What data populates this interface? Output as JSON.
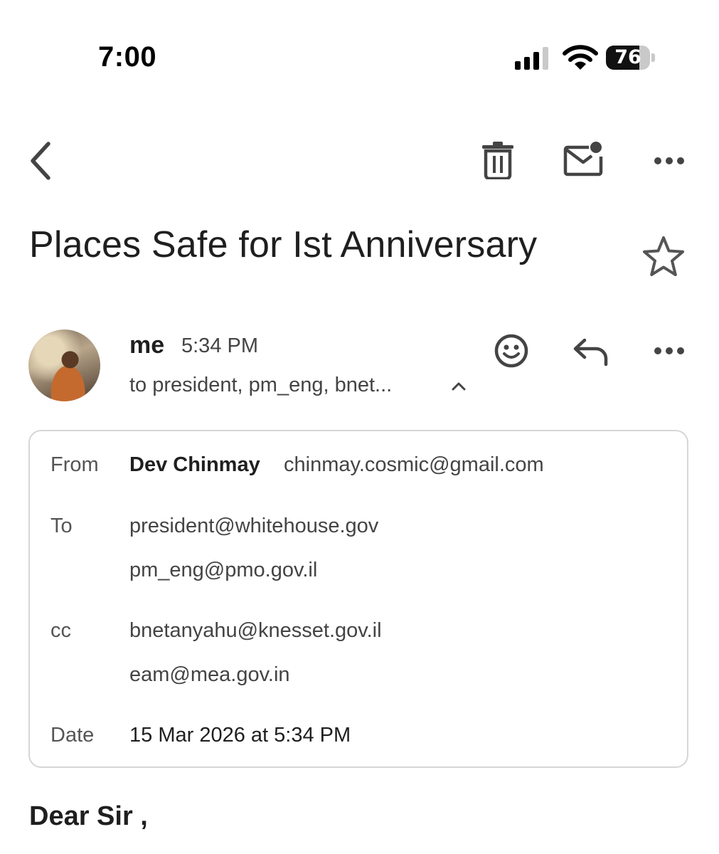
{
  "status_bar": {
    "time": "7:00",
    "battery_level": "76",
    "battery_fraction": 0.76
  },
  "toolbar": {
    "back_icon": "chevron-left-icon",
    "delete_icon": "trash-icon",
    "unread_icon": "mark-unread-icon",
    "more_icon": "more-horizontal-icon"
  },
  "email": {
    "subject": "Places Safe for Ist Anniversary",
    "sender_label": "me",
    "sent_time": "5:34 PM",
    "recipients_summary": "to president, pm_eng, bnet...",
    "details": {
      "from_label": "From",
      "from_name": "Dev Chinmay",
      "from_email": "chinmay.cosmic@gmail.com",
      "to_label": "To",
      "to": [
        "president@whitehouse.gov",
        "pm_eng@pmo.gov.il"
      ],
      "cc_label": "cc",
      "cc": [
        "bnetanyahu@knesset.gov.il",
        "eam@mea.gov.in"
      ],
      "date_label": "Date",
      "date": "15 Mar 2026 at 5:34 PM"
    },
    "body_greeting": "Dear Sir ,"
  },
  "colors": {
    "text": "#1f1f1f",
    "secondary": "#444444",
    "border": "#d6d6d6",
    "icon": "#444444"
  }
}
